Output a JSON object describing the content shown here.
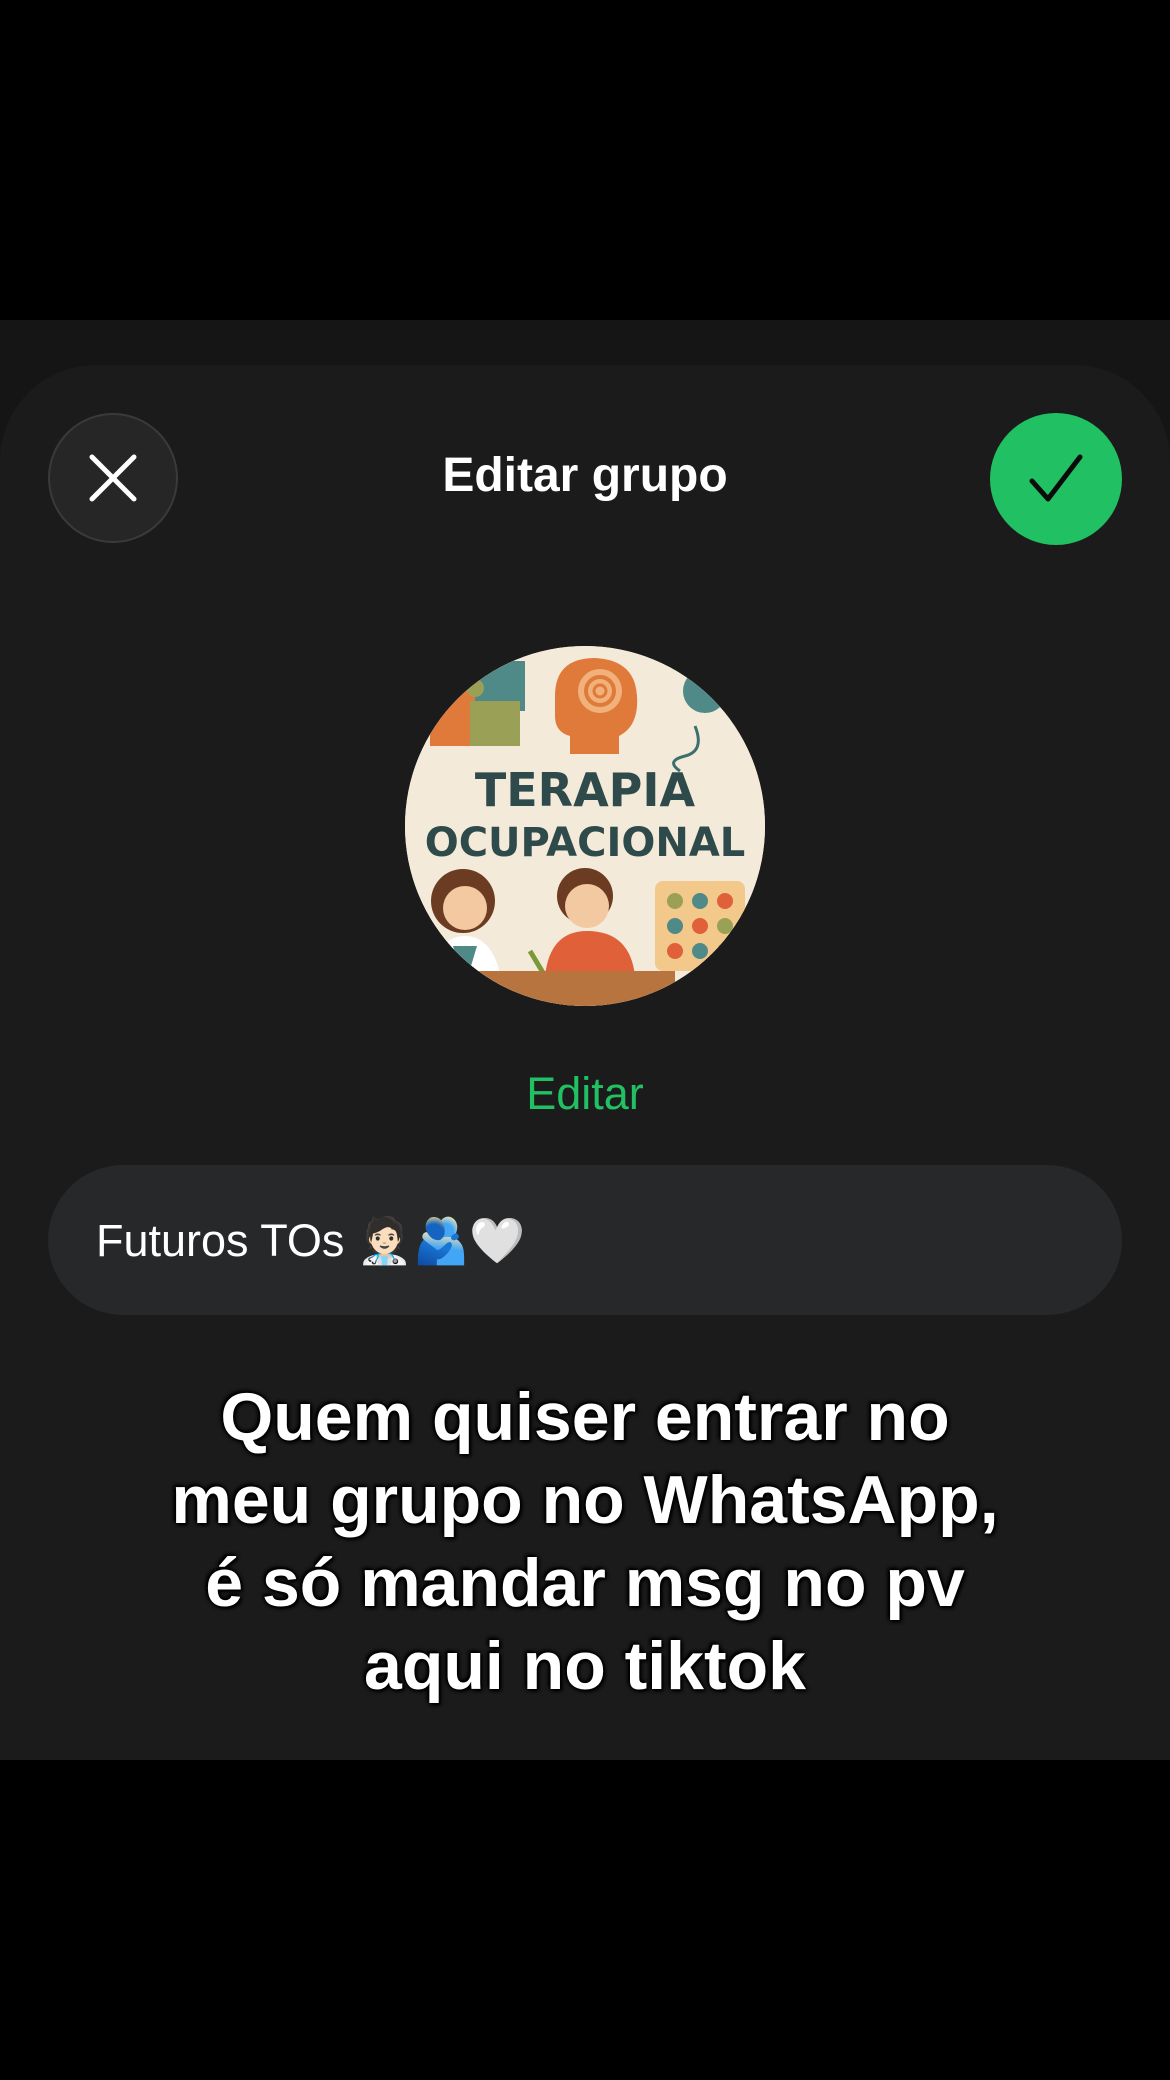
{
  "header": {
    "title": "Editar grupo",
    "close_icon": "close-icon",
    "confirm_icon": "checkmark-icon"
  },
  "avatar": {
    "line1": "TERAPIA",
    "line2": "OCUPACIONAL"
  },
  "edit_label": "Editar",
  "group_name": {
    "value": "Futuros TOs 🧑🏻‍⚕️🫂🤍"
  },
  "caption": {
    "lines": [
      "Quem quiser entrar no",
      "meu grupo no WhatsApp,",
      "é só mandar msg no pv",
      "aqui no tiktok"
    ]
  },
  "colors": {
    "accent": "#21c063",
    "sheet": "#1b1b1b",
    "field": "#262829"
  }
}
